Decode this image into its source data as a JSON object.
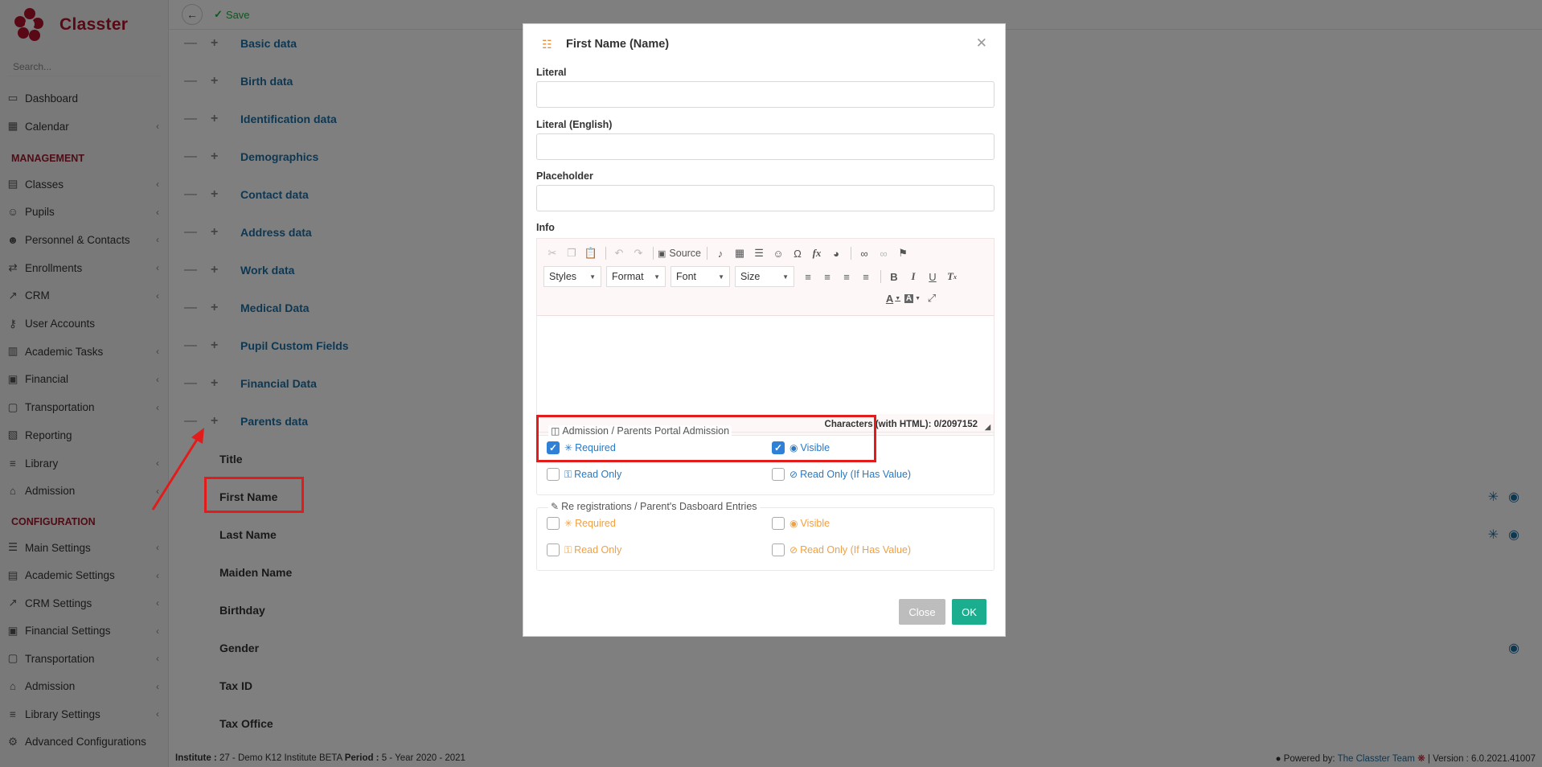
{
  "app": {
    "name": "Classter"
  },
  "sidebar": {
    "search_placeholder": "Search...",
    "items_top": [
      {
        "label": "Dashboard",
        "icon": "laptop-icon",
        "chevron": false
      },
      {
        "label": "Calendar",
        "icon": "calendar-icon",
        "chevron": true
      }
    ],
    "management_title": "MANAGEMENT",
    "management": [
      {
        "label": "Classes",
        "icon": "grid-icon",
        "chevron": true
      },
      {
        "label": "Pupils",
        "icon": "users-icon",
        "chevron": true
      },
      {
        "label": "Personnel & Contacts",
        "icon": "user-tie-icon",
        "chevron": true
      },
      {
        "label": "Enrollments",
        "icon": "exchange-icon",
        "chevron": true
      },
      {
        "label": "CRM",
        "icon": "chart-line-icon",
        "chevron": true
      },
      {
        "label": "User Accounts",
        "icon": "key-icon",
        "chevron": false
      },
      {
        "label": "Academic Tasks",
        "icon": "tasks-icon",
        "chevron": true
      },
      {
        "label": "Financial",
        "icon": "money-icon",
        "chevron": true
      },
      {
        "label": "Transportation",
        "icon": "bus-icon",
        "chevron": true
      },
      {
        "label": "Reporting",
        "icon": "print-icon",
        "chevron": false
      },
      {
        "label": "Library",
        "icon": "books-icon",
        "chevron": true
      },
      {
        "label": "Admission",
        "icon": "bank-icon",
        "chevron": true
      }
    ],
    "configuration_title": "CONFIGURATION",
    "configuration": [
      {
        "label": "Main Settings",
        "icon": "sliders-icon",
        "chevron": true
      },
      {
        "label": "Academic Settings",
        "icon": "grid-icon",
        "chevron": true
      },
      {
        "label": "CRM Settings",
        "icon": "chart-line-icon",
        "chevron": true
      },
      {
        "label": "Financial Settings",
        "icon": "money-icon",
        "chevron": true
      },
      {
        "label": "Transportation",
        "icon": "bus-icon",
        "chevron": true
      },
      {
        "label": "Admission",
        "icon": "bank-icon",
        "chevron": true
      },
      {
        "label": "Library Settings",
        "icon": "books-icon",
        "chevron": true
      },
      {
        "label": "Advanced Configurations",
        "icon": "gears-icon",
        "chevron": false
      }
    ]
  },
  "toolbar": {
    "save_label": "Save"
  },
  "sections": [
    "Basic data",
    "Birth data",
    "Identification data",
    "Demographics",
    "Contact data",
    "Address data",
    "Work data",
    "Medical Data",
    "Pupil Custom Fields",
    "Financial Data",
    "Parents data"
  ],
  "fields": [
    {
      "label": "Title",
      "required": false,
      "visible": false
    },
    {
      "label": "First Name",
      "required": true,
      "visible": true
    },
    {
      "label": "Last Name",
      "required": true,
      "visible": true
    },
    {
      "label": "Maiden Name",
      "required": false,
      "visible": false
    },
    {
      "label": "Birthday",
      "required": false,
      "visible": false
    },
    {
      "label": "Gender",
      "required": false,
      "visible": true
    },
    {
      "label": "Tax ID",
      "required": false,
      "visible": false
    },
    {
      "label": "Tax Office",
      "required": false,
      "visible": false
    }
  ],
  "footer": {
    "institute_label": "Institute :",
    "institute_value": " 27 - Demo K12 Institute BETA ",
    "period_label": "Period :",
    "period_value": " 5 - Year 2020 - 2021",
    "powered_by": "Powered by: ",
    "team": "The Classter Team",
    "version": "| Version : 6.0.2021.41007"
  },
  "modal": {
    "title": "First Name (Name)",
    "literal_label": "Literal",
    "literal_value": "",
    "literal_en_label": "Literal (English)",
    "literal_en_value": "",
    "placeholder_label": "Placeholder",
    "placeholder_value": "",
    "info_label": "Info",
    "editor": {
      "source_label": "Source",
      "styles": "Styles",
      "format": "Format",
      "font": "Font",
      "size": "Size",
      "chars": "Characters (with HTML): 0/2097152"
    },
    "group1": {
      "title": "Admission / Parents Portal Admission",
      "required_label": "Required",
      "required": true,
      "visible_label": "Visible",
      "visible": true,
      "readonly_label": "Read Only",
      "readonly": false,
      "readonly_if_label": "Read Only (If Has Value)",
      "readonly_if": false
    },
    "group2": {
      "title": "Re registrations / Parent's Dasboard Entries",
      "required_label": "Required",
      "required": false,
      "visible_label": "Visible",
      "visible": false,
      "readonly_label": "Read Only",
      "readonly": false,
      "readonly_if_label": "Read Only (If Has Value)",
      "readonly_if": false
    },
    "close_label": "Close",
    "ok_label": "OK"
  },
  "colors": {
    "brand": "#b3132b",
    "link": "#1d6fa5",
    "ok": "#1aae8f",
    "annotation": "#e21b1b"
  }
}
